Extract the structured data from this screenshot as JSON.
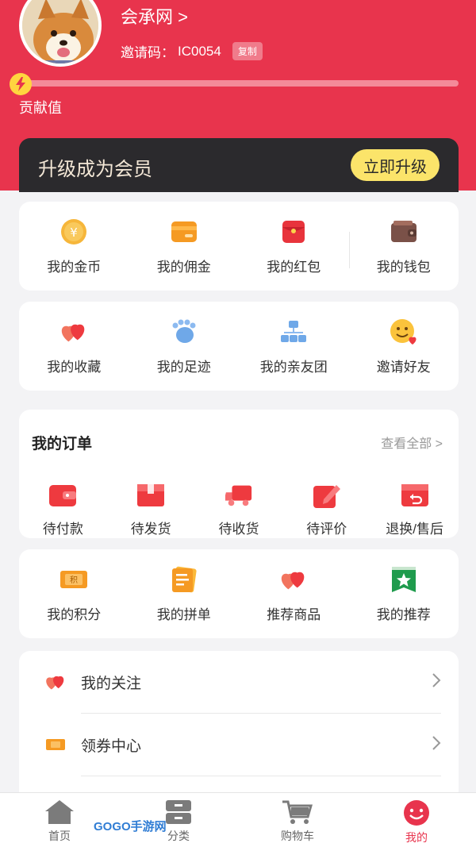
{
  "profile": {
    "username": "会承网 >",
    "invite_label": "邀请码：",
    "invite_code": "IC0054",
    "copy_label": "复制",
    "contribution_label": "贡献值",
    "contribution_progress": 0
  },
  "member": {
    "title": "升级成为会员",
    "upgrade_label": "立即升级"
  },
  "assets": [
    {
      "label": "我的金币",
      "icon": "gold-coin-icon"
    },
    {
      "label": "我的佣金",
      "icon": "commission-card-icon"
    },
    {
      "label": "我的红包",
      "icon": "red-envelope-icon"
    },
    {
      "label": "我的钱包",
      "icon": "wallet-icon"
    }
  ],
  "social": [
    {
      "label": "我的收藏",
      "icon": "hearts-icon"
    },
    {
      "label": "我的足迹",
      "icon": "footprint-icon"
    },
    {
      "label": "我的亲友团",
      "icon": "group-icon"
    },
    {
      "label": "邀请好友",
      "icon": "smiley-icon"
    }
  ],
  "orders": {
    "title": "我的订单",
    "view_all": "查看全部 >",
    "items": [
      {
        "label": "待付款",
        "icon": "wallet-pay-icon"
      },
      {
        "label": "待发货",
        "icon": "package-icon"
      },
      {
        "label": "待收货",
        "icon": "truck-icon"
      },
      {
        "label": "待评价",
        "icon": "pen-icon"
      },
      {
        "label": "退换/售后",
        "icon": "return-icon"
      }
    ]
  },
  "extras": [
    {
      "label": "我的积分",
      "icon": "points-ticket-icon"
    },
    {
      "label": "我的拼单",
      "icon": "group-order-icon"
    },
    {
      "label": "推荐商品",
      "icon": "hearts-icon"
    },
    {
      "label": "我的推荐",
      "icon": "star-badge-icon"
    }
  ],
  "list": [
    {
      "label": "我的关注",
      "icon": "hearts-icon"
    },
    {
      "label": "领券中心",
      "icon": "coupon-icon"
    }
  ],
  "tabs": [
    {
      "label": "首页",
      "icon": "home-icon"
    },
    {
      "label": "分类",
      "icon": "category-icon"
    },
    {
      "label": "购物车",
      "icon": "cart-icon"
    },
    {
      "label": "我的",
      "icon": "smiley-face-icon"
    }
  ],
  "watermark": "GOGO手游网",
  "colors": {
    "brand": "#e8344d",
    "member_bg": "#2b2a2d",
    "upgrade_btn": "#fbe46a"
  }
}
